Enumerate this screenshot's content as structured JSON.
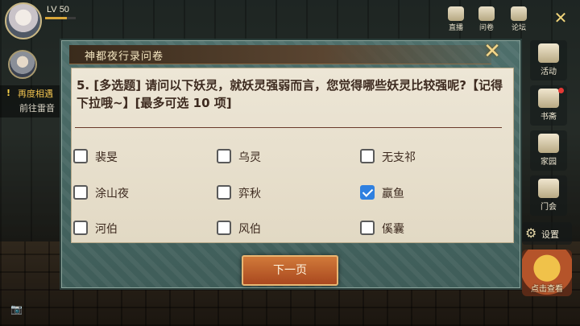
{
  "hud": {
    "level": "LV 50",
    "exp_fraction": 0.7,
    "quest_title": "再度相遇",
    "quest_subtitle": "前往雷音"
  },
  "top_icons": [
    {
      "name": "live-icon",
      "label": "直播"
    },
    {
      "name": "survey-icon",
      "label": "问卷"
    },
    {
      "name": "forum-icon",
      "label": "论坛"
    }
  ],
  "side_menu": [
    {
      "label": "活动"
    },
    {
      "label": "书斋",
      "badge": true
    },
    {
      "label": "家园"
    },
    {
      "label": "门会"
    }
  ],
  "settings_label": "设置",
  "promo_label": "点击查看",
  "dialog": {
    "title": "神都夜行录问卷",
    "question": "5. [多选题] 请问以下妖灵，就妖灵强弱而言，您觉得哪些妖灵比较强呢?【记得下拉哦~】[最多可选 10 项]",
    "options": [
      {
        "label": "裴旻",
        "checked": false
      },
      {
        "label": "乌灵",
        "checked": false
      },
      {
        "label": "无支祁",
        "checked": false
      },
      {
        "label": "涂山夜",
        "checked": false
      },
      {
        "label": "弈秋",
        "checked": false
      },
      {
        "label": "赢鱼",
        "checked": true
      },
      {
        "label": "河伯",
        "checked": false
      },
      {
        "label": "风伯",
        "checked": false
      },
      {
        "label": "傒囊",
        "checked": false
      }
    ],
    "next_button": "下一页"
  },
  "colors": {
    "accent_button": "#c0602c",
    "checkbox_checked": "#2f80e0",
    "paper": "#ede6d6",
    "dialog_frame": "#4e6f6b"
  }
}
